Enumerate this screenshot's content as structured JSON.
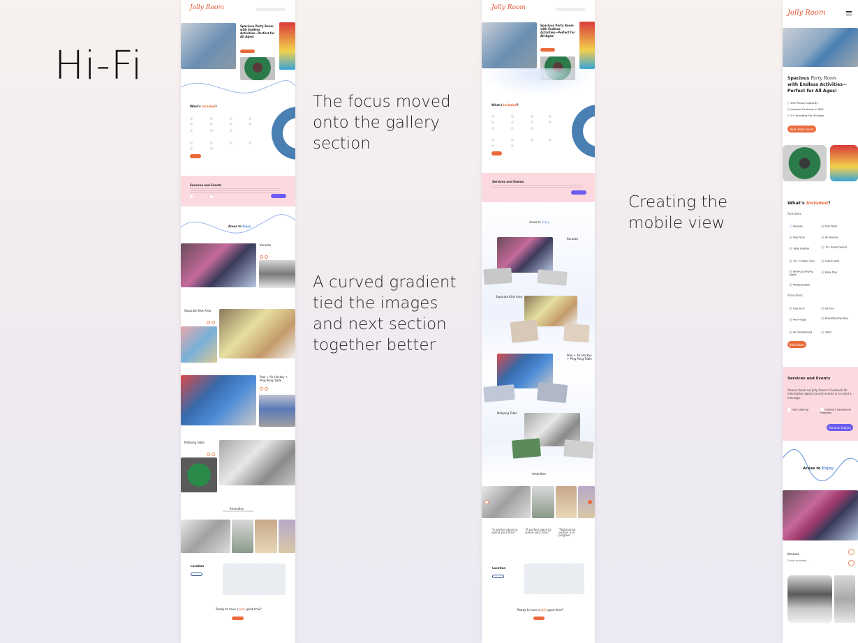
{
  "heading": "Hi-Fi",
  "notes": {
    "gallery_focus": "The focus moved onto the gallery section",
    "curved_gradient": "A curved gradient tied the images and next section together better",
    "mobile": "Creating the mobile view"
  },
  "brand": "Jolly Room",
  "mobile": {
    "hero_title_a": "Spacious",
    "hero_title_b": "Party Room",
    "hero_title_c": "with Endless Activities—",
    "hero_title_d": "Perfect for All Ages!",
    "hero_points": [
      "100 Person Capacity",
      "Located Centrally in XXX",
      "5+ Activities For All Ages"
    ],
    "book_party": "Book Party Room",
    "included_prefix": "What's",
    "included_word": "Included",
    "included_suffix": "?",
    "activities_label": "Activities",
    "activities": [
      "Karaoke",
      "Pool Table",
      "Ping Pong",
      "Air Hockey",
      "Table Football",
      "10+ Board Games",
      "10+ Children Toys",
      "Indoor Slide",
      "Blow-up Jumping Castle",
      "Baby Toys",
      "Mahjong Table"
    ],
    "amenities_label": "Amenities",
    "amenities": [
      "Free Wi-Fi",
      "Kitchen",
      "Mini-Fridge",
      "Breastfeeding Area",
      "Air Conditioning",
      "Toilet"
    ],
    "book_now": "Book Now!",
    "services_title": "Services and Events",
    "services_text": "Please check out Jolly Room's Facebook for information about current events or to send a message.",
    "service_items": [
      "Food Catering",
      "Children's Educational Programs"
    ],
    "send_inquiry": "Send an Inquiry",
    "areas_prefix": "Areas to",
    "areas_word": "Enjoy",
    "karaoke": "Karaoke",
    "karaoke_sub": "2 mics provided ..."
  },
  "colors": {
    "accent": "#ea6a3b",
    "violet": "#6b5cf2",
    "pink": "#fcd9df",
    "logo": "#e2542f"
  }
}
